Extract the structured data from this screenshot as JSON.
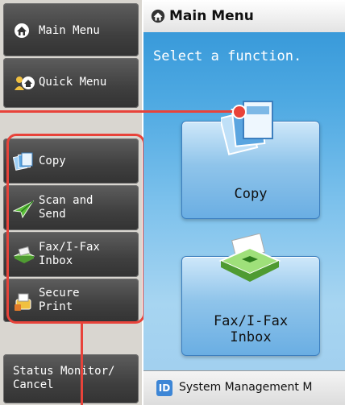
{
  "sidebar": {
    "main_menu_label": "Main Menu",
    "quick_menu_label": "Quick Menu",
    "items": [
      {
        "label": "Copy",
        "icon": "copy-icon"
      },
      {
        "label": "Scan and\nSend",
        "icon": "scan-send-icon"
      },
      {
        "label": "Fax/I-Fax\nInbox",
        "icon": "fax-inbox-icon"
      },
      {
        "label": "Secure\nPrint",
        "icon": "secure-print-icon"
      }
    ],
    "status_monitor_label": "Status Monitor/\nCancel"
  },
  "main": {
    "title": "Main Menu",
    "subtitle": "Select a function.",
    "functions": [
      {
        "label": "Copy"
      },
      {
        "label": "Fax/I-Fax\nInbox"
      }
    ]
  },
  "bottom_bar": {
    "id_badge": "ID",
    "text": "System Management M"
  },
  "colors": {
    "highlight": "#e8433a",
    "sidebar_button": "#3f3f3f",
    "main_background": "#4ea9e2"
  }
}
